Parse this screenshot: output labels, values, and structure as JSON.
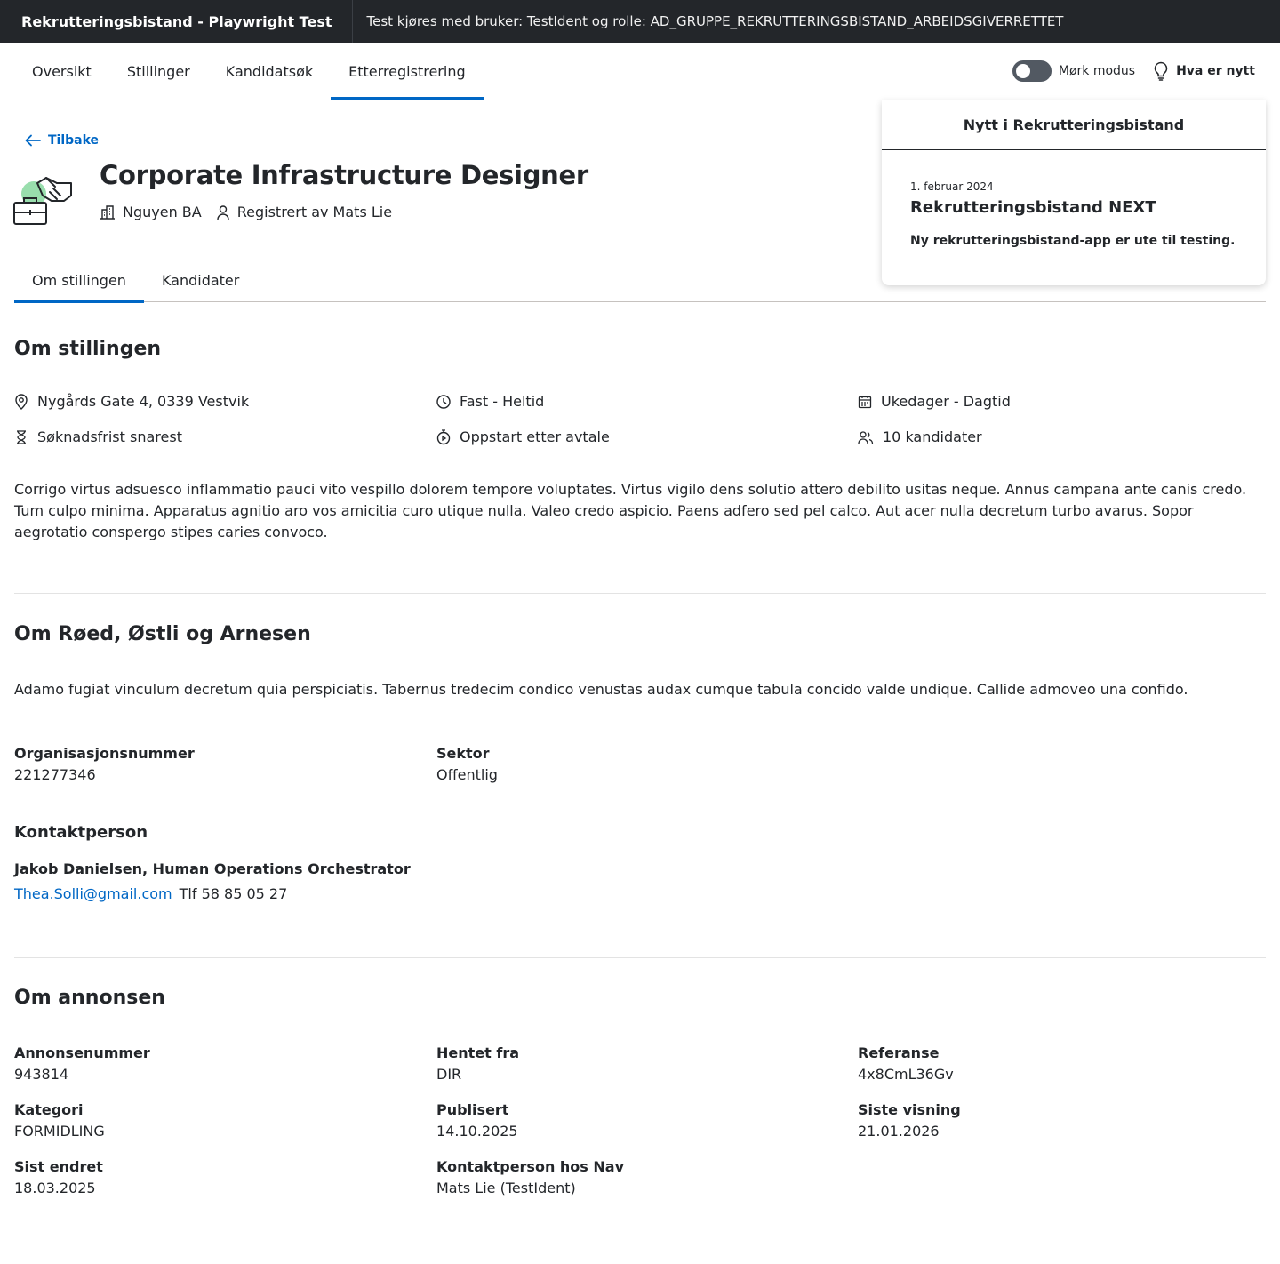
{
  "topbar": {
    "app_title": "Rekrutteringsbistand - Playwright Test",
    "test_info": "Test kjøres med bruker: TestIdent og rolle: AD_GRUPPE_REKRUTTERINGSBISTAND_ARBEIDSGIVERRETTET"
  },
  "nav": {
    "tabs": [
      "Oversikt",
      "Stillinger",
      "Kandidatsøk",
      "Etterregistrering"
    ],
    "active_tab": "Etterregistrering",
    "dark_mode_label": "Mørk modus",
    "news_label": "Hva er nytt"
  },
  "news_panel": {
    "title": "Nytt i Rekrutteringsbistand",
    "date": "1. februar 2024",
    "headline": "Rekrutteringsbistand NEXT",
    "text": "Ny rekrutteringsbistand-app er ute til testing."
  },
  "header": {
    "back_label": "Tilbake",
    "job_title": "Corporate Infrastructure Designer",
    "employer": "Nguyen BA",
    "registered_by": "Registrert av Mats Lie"
  },
  "sub_tabs": [
    "Om stillingen",
    "Kandidater"
  ],
  "om_stillingen": {
    "heading": "Om stillingen",
    "facts": {
      "address": "Nygårds Gate 4, 0339 Vestvik",
      "employment": "Fast - Heltid",
      "workdays": "Ukedager - Dagtid",
      "deadline": "Søknadsfrist snarest",
      "start": "Oppstart etter avtale",
      "candidates": "10 kandidater"
    },
    "description": "Corrigo virtus adsuesco inflammatio pauci vito vespillo dolorem tempore voluptates. Virtus vigilo dens solutio attero debilito usitas neque. Annus campana ante canis credo. Tum culpo minima. Apparatus agnitio aro vos amicitia curo utique nulla. Valeo credo aspicio. Paens adfero sed pel calco. Aut acer nulla decretum turbo avarus. Sopor aegrotatio conspergo stipes caries convoco."
  },
  "om_bedrift": {
    "heading": "Om Røed, Østli og Arnesen",
    "description": "Adamo fugiat vinculum decretum quia perspiciatis. Tabernus tredecim condico venustas audax cumque tabula concido valde undique. Callide admoveo una confido.",
    "orgnr_label": "Organisasjonsnummer",
    "orgnr": "221277346",
    "sector_label": "Sektor",
    "sector": "Offentlig",
    "contact_heading": "Kontaktperson",
    "contact_name": "Jakob Danielsen, Human Operations Orchestrator",
    "contact_email": "Thea.Solli@gmail.com",
    "contact_phone": "Tlf 58 85 05 27"
  },
  "om_annonsen": {
    "heading": "Om annonsen",
    "fields": [
      {
        "label": "Annonsenummer",
        "value": "943814"
      },
      {
        "label": "Hentet fra",
        "value": "DIR"
      },
      {
        "label": "Referanse",
        "value": "4x8CmL36Gv"
      },
      {
        "label": "Kategori",
        "value": "FORMIDLING"
      },
      {
        "label": "Publisert",
        "value": "14.10.2025"
      },
      {
        "label": "Siste visning",
        "value": "21.01.2026"
      },
      {
        "label": "Sist endret",
        "value": "18.03.2025"
      },
      {
        "label": "Kontaktperson hos Nav",
        "value": "Mats Lie (TestIdent)"
      }
    ]
  },
  "colors": {
    "topbar_bg": "#23262a",
    "accent": "#0067c5",
    "icon_green": "#99dead"
  }
}
